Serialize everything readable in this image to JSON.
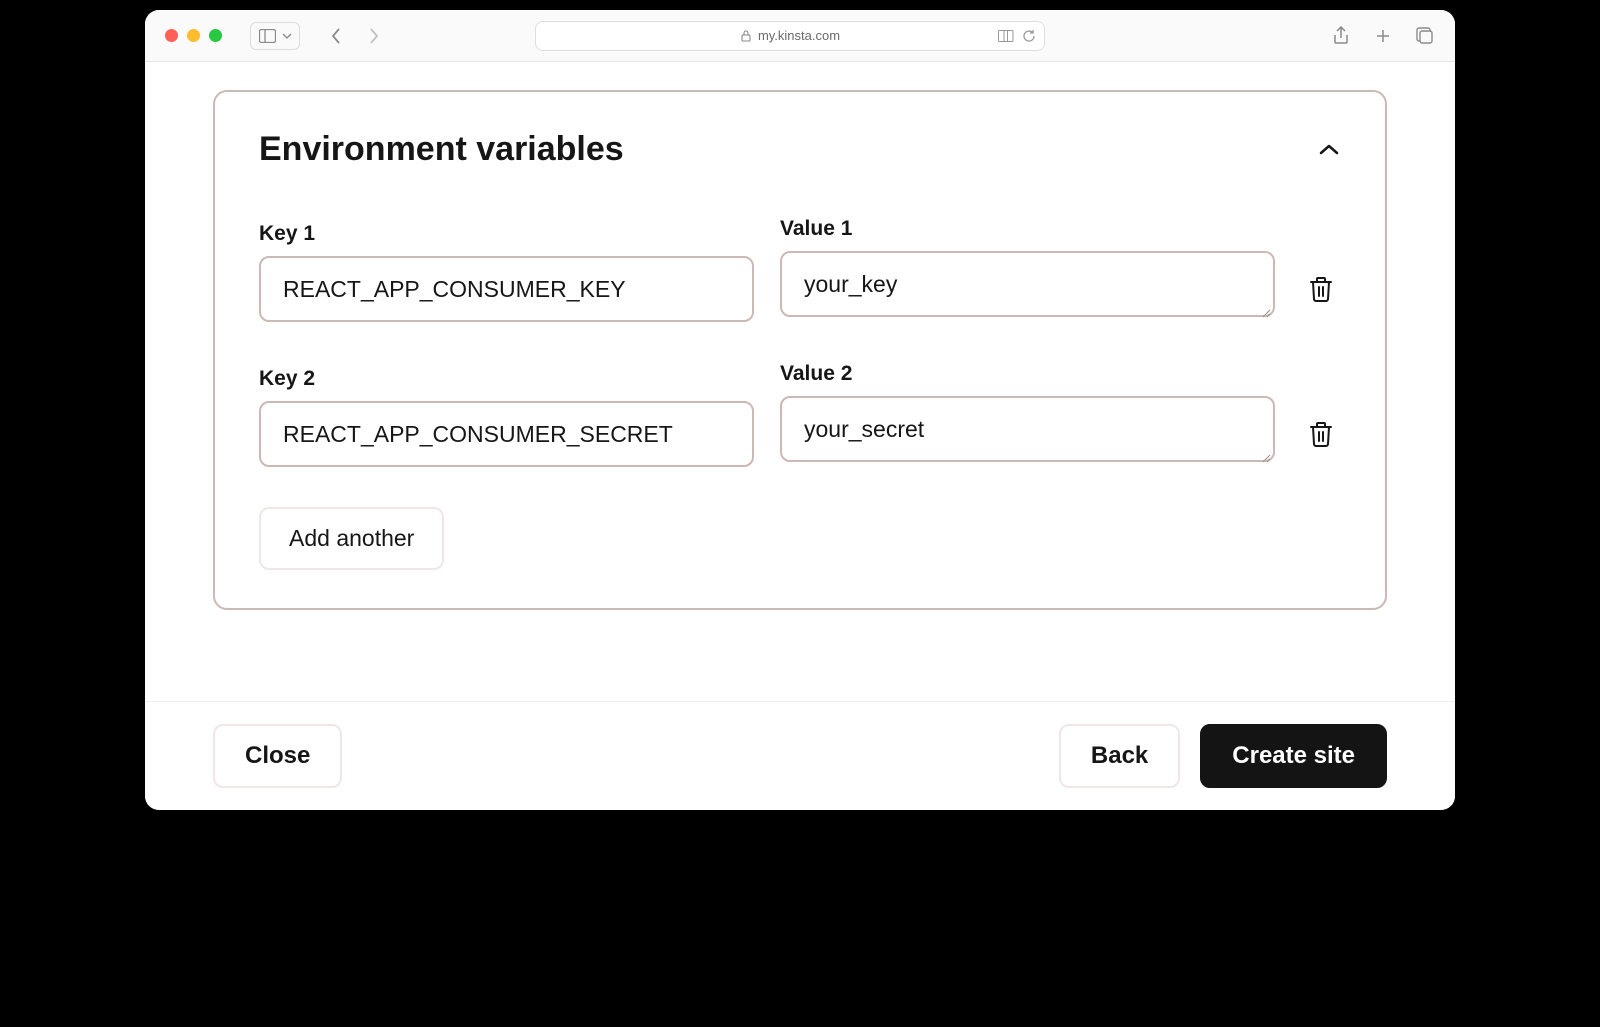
{
  "browser": {
    "url": "my.kinsta.com"
  },
  "panel": {
    "title": "Environment variables",
    "add_another_label": "Add another"
  },
  "vars": [
    {
      "key_label": "Key 1",
      "key_value": "REACT_APP_CONSUMER_KEY",
      "value_label": "Value 1",
      "value_value": "your_key"
    },
    {
      "key_label": "Key 2",
      "key_value": "REACT_APP_CONSUMER_SECRET",
      "value_label": "Value 2",
      "value_value": "your_secret"
    }
  ],
  "footer": {
    "close_label": "Close",
    "back_label": "Back",
    "create_label": "Create site"
  }
}
